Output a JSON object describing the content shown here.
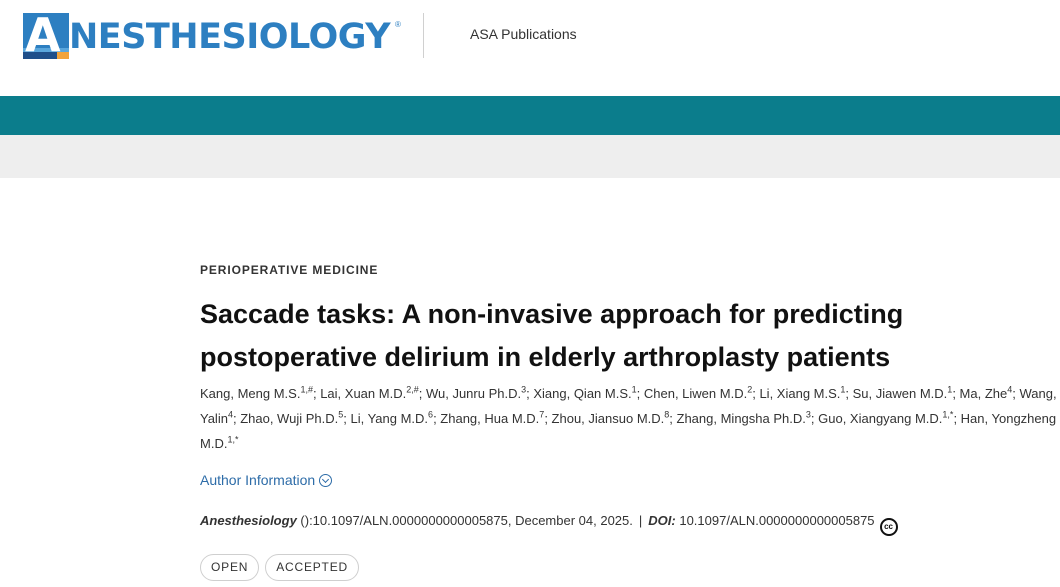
{
  "header": {
    "logo_first_letter": "A",
    "logo_rest": "NESTHESIOLOGY",
    "logo_reg": "®",
    "publications_link": "ASA Publications"
  },
  "article": {
    "category": "PERIOPERATIVE MEDICINE",
    "title": "Saccade tasks: A non-invasive approach for predicting postoperative delirium in elderly arthroplasty patients",
    "authors": [
      {
        "name": "Kang, Meng M.S.",
        "sup": "1,#"
      },
      {
        "name": "Lai, Xuan M.D.",
        "sup": "2,#"
      },
      {
        "name": "Wu, Junru Ph.D.",
        "sup": "3"
      },
      {
        "name": "Xiang, Qian M.S.",
        "sup": "1"
      },
      {
        "name": "Chen, Liwen M.D.",
        "sup": "2"
      },
      {
        "name": "Li, Xiang M.S.",
        "sup": "1"
      },
      {
        "name": "Su, Jiawen M.D.",
        "sup": "1"
      },
      {
        "name": "Ma, Zhe",
        "sup": "4"
      },
      {
        "name": "Wang, Yalin",
        "sup": "4"
      },
      {
        "name": "Zhao, Wuji Ph.D.",
        "sup": "5"
      },
      {
        "name": "Li, Yang M.D.",
        "sup": "6"
      },
      {
        "name": "Zhang, Hua M.D.",
        "sup": "7"
      },
      {
        "name": "Zhou, Jiansuo M.D.",
        "sup": "8"
      },
      {
        "name": "Zhang, Mingsha Ph.D.",
        "sup": "3"
      },
      {
        "name": "Guo, Xiangyang M.D.",
        "sup": "1,*"
      },
      {
        "name": "Han, Yongzheng M.D.",
        "sup": "1,*"
      }
    ],
    "author_info_label": "Author Information",
    "citation": {
      "journal": "Anesthesiology",
      "details": " ():10.1097/ALN.0000000000005875, December 04, 2025.",
      "separator": "|",
      "doi_label": "DOI:",
      "doi_value": " 10.1097/ALN.0000000000005875",
      "license_icon_text": "cc"
    },
    "badges": [
      "OPEN",
      "ACCEPTED"
    ]
  }
}
